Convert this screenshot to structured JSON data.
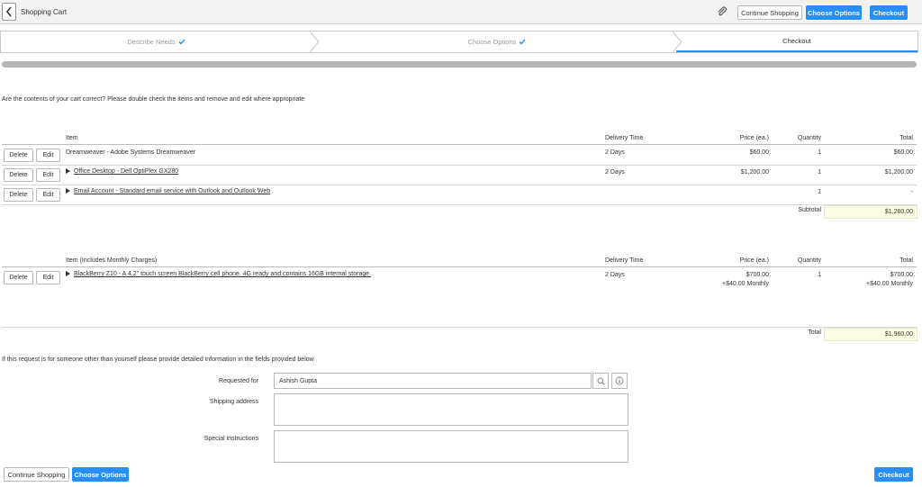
{
  "header": {
    "title": "Shopping Cart",
    "continue_label": "Continue Shopping",
    "choose_label": "Choose Options",
    "checkout_label": "Checkout"
  },
  "stepper": {
    "steps": [
      {
        "label": "Describe Needs",
        "status": "complete"
      },
      {
        "label": "Choose Options",
        "status": "complete"
      },
      {
        "label": "Checkout",
        "status": "active"
      }
    ]
  },
  "intro": "Are the contents of your cart correct? Please double check the items and remove and edit where appropriate",
  "cart": {
    "headers": {
      "item": "Item",
      "delivery": "Delivery Time",
      "price": "Price (ea.)",
      "quantity": "Quantity",
      "total": "Total"
    },
    "row_buttons": {
      "delete": "Delete",
      "edit": "Edit"
    },
    "rows": [
      {
        "item": "Dreamweaver - Adobe Systems Dreamweaver",
        "expandable": false,
        "delivery": "2 Days",
        "price": "$60.00",
        "quantity": "1",
        "total": "$60.00"
      },
      {
        "item": "Office Desktop - Dell OptiPlex GX280",
        "expandable": true,
        "delivery": "2 Days",
        "price": "$1,200.00",
        "quantity": "1",
        "total": "$1,200.00"
      },
      {
        "item": "Email Account - Standard email service with Outlook and Outlook Web",
        "expandable": true,
        "delivery": "",
        "price": "",
        "quantity": "1",
        "total": "-"
      }
    ],
    "subtotal_label": "Subtotal",
    "subtotal_value": "$1,260.00"
  },
  "monthly": {
    "headers": {
      "item": "Item (Includes Monthly Charges)",
      "delivery": "Delivery Time",
      "price": "Price (ea.)",
      "quantity": "Quantity",
      "total": "Total"
    },
    "rows": [
      {
        "item": "BlackBerry Z10 - A 4.2\" touch screen BlackBerry cell phone. 4G ready and contains 16GB internal storage.",
        "expandable": true,
        "delivery": "2 Days",
        "price": "$700.00",
        "price_monthly": "+$40.00 Monthly",
        "quantity": "1",
        "total": "$700.00",
        "total_monthly": "+$40.00 Monthly"
      }
    ],
    "total_label": "Total",
    "total_value": "$1,960.00"
  },
  "form": {
    "intro": "If this request is for someone other than yourself please provide detailed information in the fields provided below",
    "requested_for_label": "Requested for",
    "requested_for_value": "Ashish Gupta",
    "shipping_label": "Shipping address",
    "shipping_value": "",
    "instructions_label": "Special instructions",
    "instructions_value": ""
  },
  "footer": {
    "continue_label": "Continue Shopping",
    "choose_label": "Choose Options",
    "checkout_label": "Checkout"
  },
  "colors": {
    "primary": "#278efc",
    "highlight": "#fdfde6"
  },
  "icons": [
    "back-arrow-icon",
    "attachment-icon",
    "check-icon",
    "expand-triangle-icon",
    "search-icon",
    "info-icon"
  ]
}
